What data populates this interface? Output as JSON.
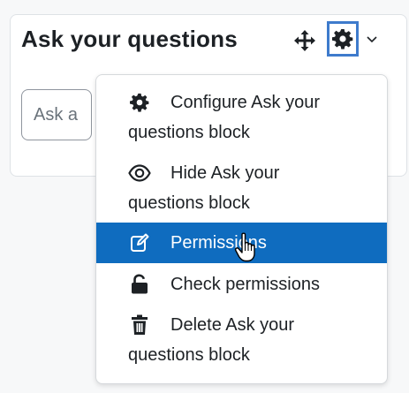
{
  "block": {
    "title": "Ask your questions",
    "input_placeholder": "Ask a",
    "move_icon": "move-arrows-icon",
    "gear_icon": "gear-icon",
    "dropdown_icon": "chevron-down-icon"
  },
  "menu": {
    "items": [
      {
        "icon": "gear-icon",
        "line1": "Configure Ask your",
        "line2": "questions block",
        "active": false
      },
      {
        "icon": "eye-icon",
        "line1": "Hide Ask your",
        "line2": "questions block",
        "active": false
      },
      {
        "icon": "edit-icon",
        "line1": "Permissions",
        "line2": "",
        "active": true
      },
      {
        "icon": "unlock-icon",
        "line1": "Check permissions",
        "line2": "",
        "active": false
      },
      {
        "icon": "trash-icon",
        "line1": "Delete Ask your",
        "line2": "questions block",
        "active": false
      }
    ]
  },
  "colors": {
    "accent": "#0f6cbf",
    "focus_outline": "#3e7bcc",
    "page_bg": "#f7f8f9",
    "text": "#1d2125"
  }
}
